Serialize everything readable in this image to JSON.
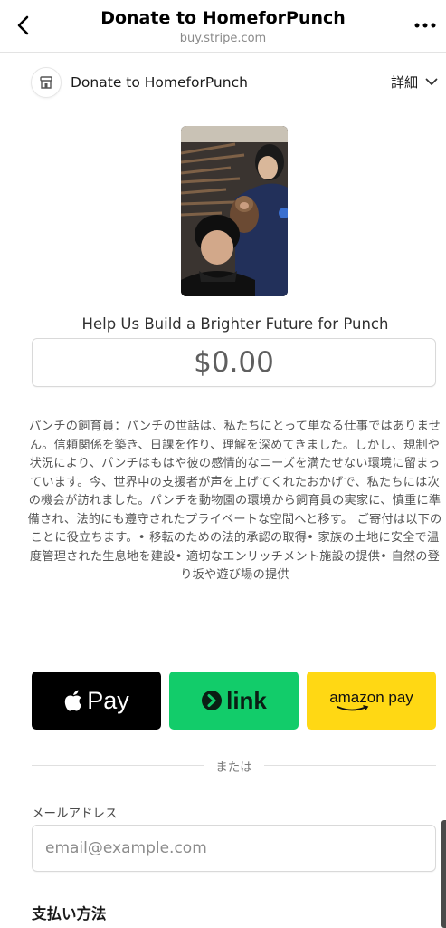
{
  "browser": {
    "title": "Donate to HomeforPunch",
    "url": "buy.stripe.com",
    "back_icon": "chevron-left-icon",
    "more_icon": "more-horizontal-icon"
  },
  "merchant": {
    "name": "Donate to HomeforPunch",
    "details_label": "詳細",
    "icon": "storefront-icon"
  },
  "product": {
    "title": "Help Us Build a Brighter Future for Punch",
    "amount": "$0.00",
    "description": "パンチの飼育員：パンチの世話は、私たちにとって単なる仕事ではありません。信頼関係を築き、日課を作り、理解を深めてきました。しかし、規制や状況により、パンチはもはや彼の感情的なニーズを満たせない環境に留まっています。今、世界中の支援者が声を上げてくれたおかげで、私たちには次の機会が訪れました。パンチを動物園の環境から飼育員の実家に、慎重に準備され、法的にも遵守されたプライベートな空間へと移す。 ご寄付は以下のことに役立ちます。• 移転のための法的承認の取得• 家族の土地に安全で温度管理された生息地を建設• 適切なエンリッチメント施設の提供• 自然の登り坂や遊び場の提供"
  },
  "wallets": {
    "apple_pay_label": "Pay",
    "link_label": "link",
    "amazon_pay_label": "amazon pay"
  },
  "divider_text": "または",
  "email": {
    "label": "メールアドレス",
    "placeholder": "email@example.com",
    "value": ""
  },
  "payment_method_label": "支払い方法",
  "colors": {
    "link_green": "#12cc6a",
    "amazon_yellow": "#ffd814",
    "apple_black": "#000000"
  }
}
